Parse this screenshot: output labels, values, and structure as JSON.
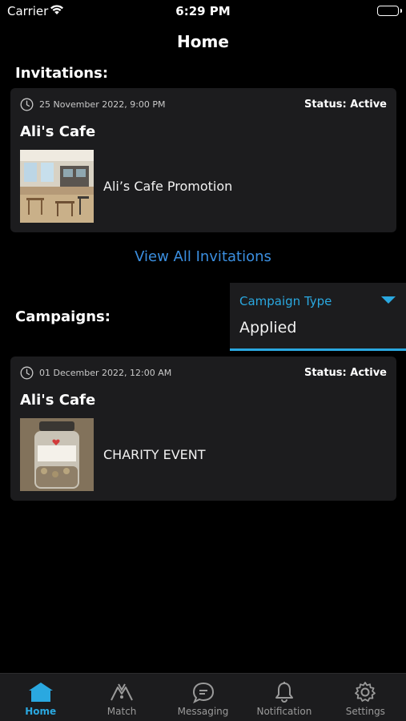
{
  "status_bar": {
    "carrier": "Carrier",
    "time": "6:29 PM"
  },
  "header": {
    "title": "Home"
  },
  "invitations": {
    "section_title": "Invitations:",
    "cards": [
      {
        "date": "25 November 2022, 9:00 PM",
        "status": "Status: Active",
        "business_name": "Ali's Cafe",
        "title": "Ali’s Cafe Promotion"
      }
    ],
    "view_all_label": "View All Invitations"
  },
  "campaigns": {
    "section_title": "Campaigns:",
    "filter": {
      "label": "Campaign Type",
      "value": "Applied"
    },
    "cards": [
      {
        "date": "01 December 2022, 12:00 AM",
        "status": "Status: Active",
        "business_name": "Ali's Cafe",
        "title": "CHARITY EVENT"
      }
    ]
  },
  "tab_bar": {
    "active": "Home",
    "tabs": [
      {
        "label": "Home",
        "icon": "home-icon"
      },
      {
        "label": "Match",
        "icon": "match-icon"
      },
      {
        "label": "Messaging",
        "icon": "messaging-icon"
      },
      {
        "label": "Notification",
        "icon": "bell-icon"
      },
      {
        "label": "Settings",
        "icon": "gear-icon"
      }
    ]
  },
  "colors": {
    "background": "#000000",
    "card": "#1c1c1e",
    "accent": "#2aa8e0",
    "link": "#3b8fe0"
  }
}
